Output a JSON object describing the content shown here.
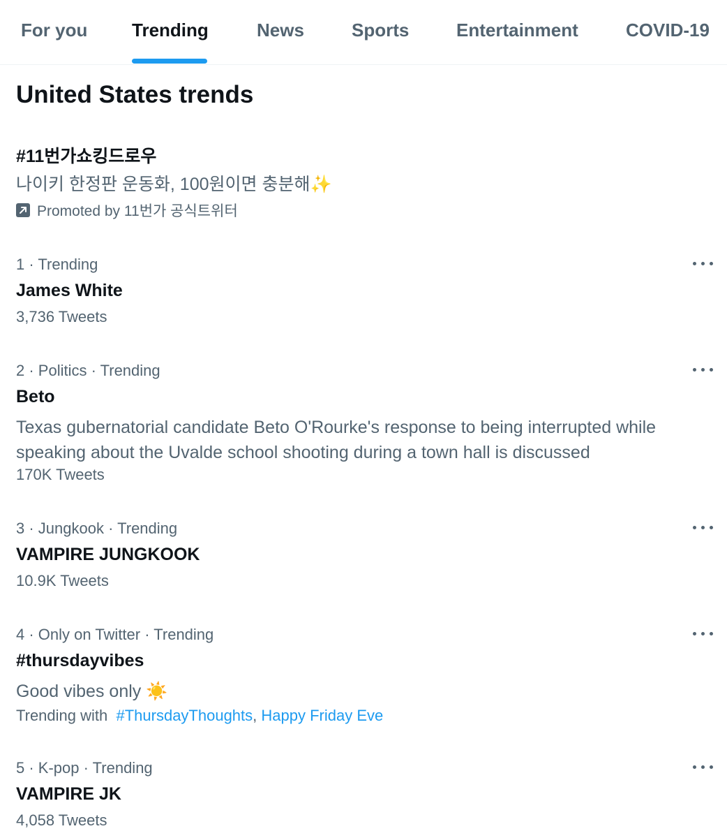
{
  "tabs": [
    "For you",
    "Trending",
    "News",
    "Sports",
    "Entertainment",
    "COVID-19"
  ],
  "active_tab": "Trending",
  "section_title": "United States trends",
  "promoted": {
    "title": "#11번가쇼킹드로우",
    "description": "나이키 한정판 운동화, 100원이면 충분해",
    "emoji": "✨",
    "promoted_by": "Promoted by 11번가 공식트위터"
  },
  "trends": [
    {
      "meta": "1 · Trending",
      "name": "James White",
      "count": "3,736 Tweets"
    },
    {
      "meta": "2 · Politics · Trending",
      "name": "Beto",
      "description": "Texas gubernatorial candidate Beto O'Rourke's response to being interrupted while speaking about the Uvalde school shooting during a town hall is discussed",
      "count": "170K Tweets"
    },
    {
      "meta": "3 · Jungkook · Trending",
      "name": "VAMPIRE JUNGKOOK",
      "count": "10.9K Tweets"
    },
    {
      "meta": "4 · Only on Twitter · Trending",
      "name": "#thursdayvibes",
      "description": "Good vibes only",
      "emoji": "☀️",
      "trending_with_label": "Trending with",
      "trending_with": [
        "#ThursdayThoughts",
        "Happy Friday Eve"
      ],
      "separator": ","
    },
    {
      "meta": "5 · K-pop · Trending",
      "name": "VAMPIRE JK",
      "count": "4,058 Tweets"
    }
  ],
  "colors": {
    "accent": "#1d9bf0",
    "text_primary": "#0f1419",
    "text_secondary": "#536471"
  },
  "icons": {
    "promoted": "promoted-arrow-icon",
    "more": "more-dots-icon"
  }
}
